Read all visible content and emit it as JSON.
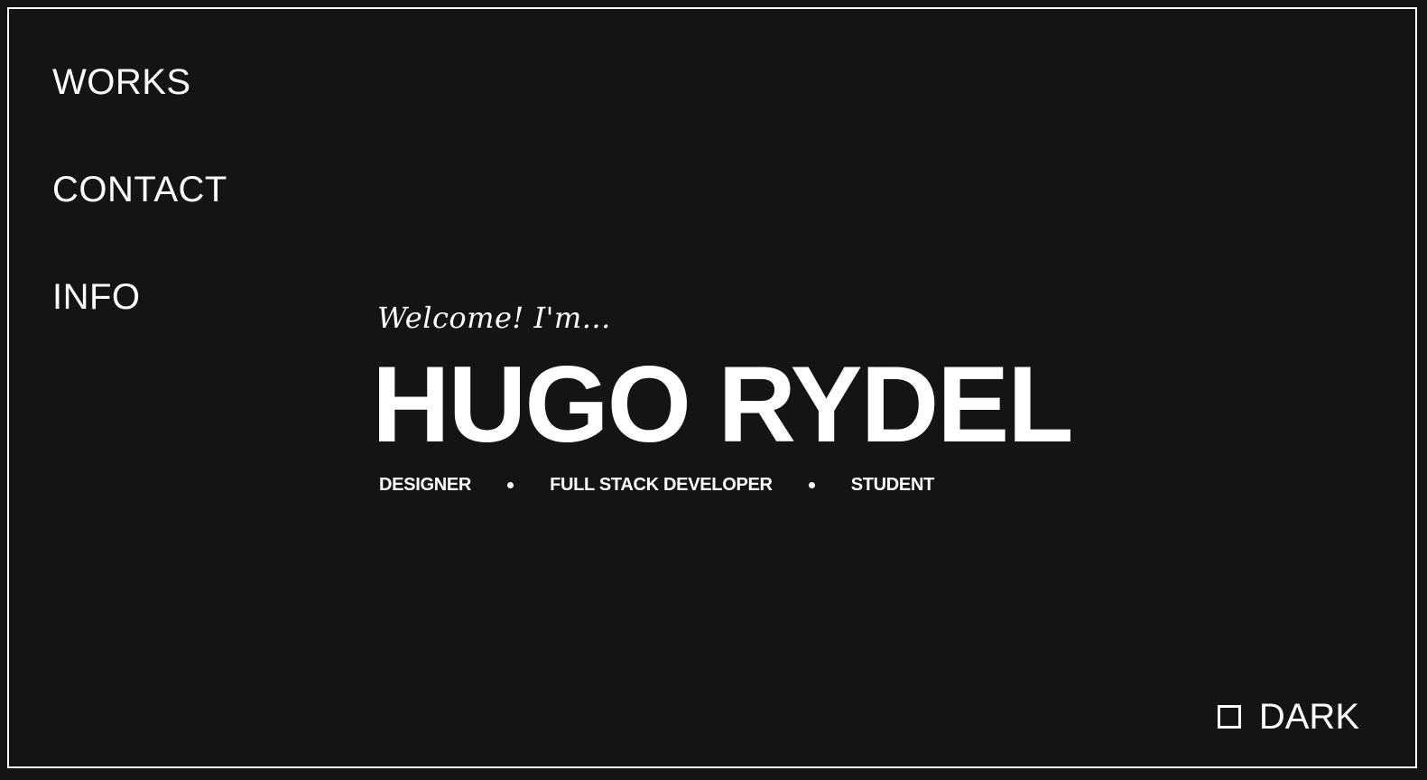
{
  "nav": {
    "items": [
      {
        "label": "WORKS"
      },
      {
        "label": "CONTACT"
      },
      {
        "label": "INFO"
      }
    ]
  },
  "hero": {
    "greeting": "Welcome! I'm...",
    "name": "HUGO RYDEL",
    "roles": [
      "DESIGNER",
      "FULL STACK DEVELOPER",
      "STUDENT"
    ]
  },
  "theme_toggle": {
    "label": "DARK",
    "checked": false
  },
  "colors": {
    "background": "#141414",
    "foreground": "#ffffff"
  }
}
